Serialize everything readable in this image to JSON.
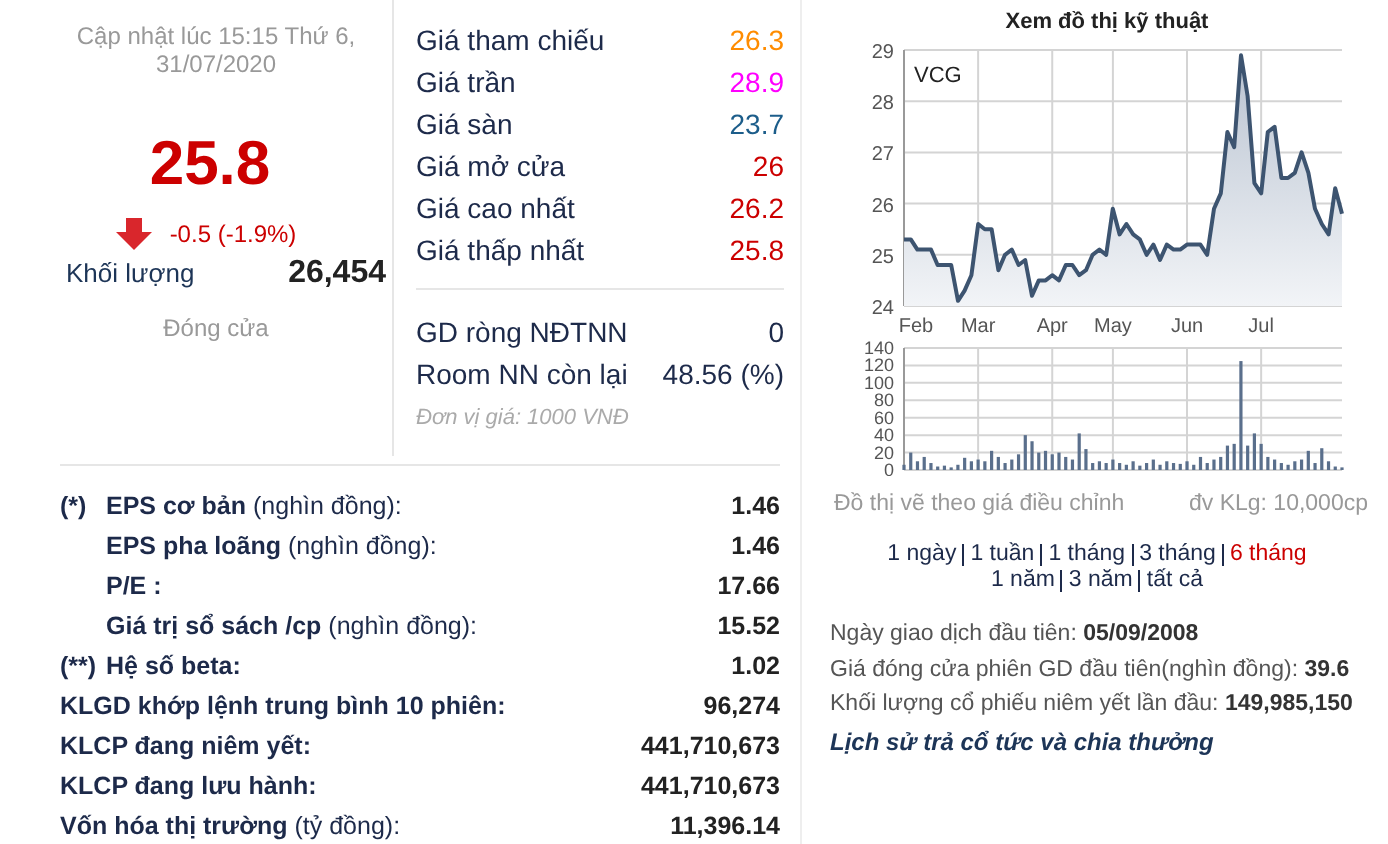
{
  "quote": {
    "updated": "Cập nhật lúc 15:15 Thứ 6, 31/07/2020",
    "price": "25.8",
    "trend_down": true,
    "change": "-0.5 (-1.9%)",
    "volume_label": "Khối lượng",
    "volume": "26,454",
    "status": "Đóng cửa"
  },
  "prices": [
    {
      "label": "Giá tham chiếu",
      "value": "26.3",
      "color": "#ff8c00"
    },
    {
      "label": "Giá trần",
      "value": "28.9",
      "color": "#ff00ff"
    },
    {
      "label": "Giá sàn",
      "value": "23.7",
      "color": "#1c5d8a"
    },
    {
      "label": "Giá mở cửa",
      "value": "26",
      "color": "#cc0000"
    },
    {
      "label": "Giá cao nhất",
      "value": "26.2",
      "color": "#cc0000"
    },
    {
      "label": "Giá thấp nhất",
      "value": "25.8",
      "color": "#cc0000"
    }
  ],
  "foreign": [
    {
      "label": "GD ròng NĐTNN",
      "value": "0"
    },
    {
      "label": "Room NN còn lại",
      "value": "48.56 (%)"
    }
  ],
  "price_unit": "Đơn vị giá: 1000 VNĐ",
  "stats": [
    {
      "marker": "(*)",
      "label": "**EPS cơ bản** (nghìn đồng):",
      "value": "1.46",
      "children": [
        {
          "label": "**EPS pha loãng** (nghìn đồng):",
          "value": "1.46"
        },
        {
          "label": "**P/E :**",
          "value": "17.66"
        },
        {
          "label": "**Giá trị sổ sách /cp** (nghìn đồng):",
          "value": "15.52"
        }
      ]
    },
    {
      "marker": "(**)",
      "label": "**Hệ số beta:**",
      "value": "1.02"
    },
    {
      "label": "**KLGD khớp lệnh trung bình 10 phiên:**",
      "value": "96,274"
    },
    {
      "label": "**KLCP đang niêm yết:**",
      "value": "441,710,673"
    },
    {
      "label": "**KLCP đang lưu hành:**",
      "value": "441,710,673"
    },
    {
      "label": "**Vốn hóa thị trường** (tỷ đồng):",
      "value": "11,396.14"
    }
  ],
  "chart": {
    "title": "Xem đồ thị kỹ thuật",
    "price_chart": {
      "chart_data": {
        "type": "area",
        "grid": true,
        "categories": [
          "Feb",
          null,
          null,
          null,
          null,
          null,
          null,
          null,
          null,
          null,
          null,
          "Mar",
          null,
          null,
          null,
          null,
          null,
          null,
          null,
          null,
          null,
          null,
          "Apr",
          null,
          null,
          null,
          null,
          null,
          null,
          null,
          null,
          "May",
          null,
          null,
          null,
          null,
          null,
          null,
          null,
          null,
          null,
          null,
          "Jun",
          null,
          null,
          null,
          null,
          null,
          null,
          null,
          null,
          null,
          null,
          "Jul",
          null,
          null,
          null,
          null,
          null,
          null,
          null,
          null,
          null,
          null,
          null,
          null
        ],
        "ylim": [
          24,
          29
        ],
        "yticks": [
          24,
          25,
          26,
          27,
          28,
          29
        ],
        "series": [
          {
            "name": "VCG",
            "color": "#3d5470",
            "values": [
              25.3,
              25.3,
              25.1,
              25.1,
              25.1,
              24.8,
              24.8,
              24.8,
              24.1,
              24.3,
              24.6,
              25.6,
              25.5,
              25.5,
              24.7,
              25.0,
              25.1,
              24.8,
              24.9,
              24.2,
              24.5,
              24.5,
              24.6,
              24.5,
              24.8,
              24.8,
              24.6,
              24.7,
              25.0,
              25.1,
              25.0,
              25.9,
              25.4,
              25.6,
              25.4,
              25.3,
              25.0,
              25.2,
              24.9,
              25.2,
              25.1,
              25.1,
              25.2,
              25.2,
              25.2,
              25.0,
              25.9,
              26.2,
              27.4,
              27.1,
              28.9,
              28.1,
              26.4,
              26.2,
              27.4,
              27.5,
              26.5,
              26.5,
              26.6,
              27.0,
              26.6,
              25.9,
              25.6,
              25.4,
              26.3,
              25.8
            ]
          }
        ]
      }
    },
    "volume_chart": {
      "chart_data": {
        "type": "bar",
        "grid": true,
        "categories": [
          null,
          null,
          null,
          null,
          null,
          null,
          null,
          null,
          null,
          null,
          null,
          null,
          null,
          null,
          null,
          null,
          null,
          null,
          null,
          null,
          null,
          null,
          null,
          null,
          null,
          null,
          null,
          null,
          null,
          null,
          null,
          null,
          null,
          null,
          null,
          null,
          null,
          null,
          null,
          null,
          null,
          null,
          null,
          null,
          null,
          null,
          null,
          null,
          null,
          null,
          null,
          null,
          null,
          null,
          null,
          null,
          null,
          null,
          null,
          null,
          null,
          null,
          null,
          null,
          null,
          null
        ],
        "ylim": [
          0,
          140
        ],
        "yticks": [
          0,
          20,
          40,
          60,
          80,
          100,
          120,
          140
        ],
        "series": [
          {
            "color": "#5a6f8c",
            "values": [
              6,
              20,
              10,
              15,
              8,
              4,
              5,
              3,
              6,
              14,
              10,
              12,
              10,
              22,
              15,
              8,
              12,
              18,
              40,
              33,
              20,
              22,
              18,
              20,
              15,
              12,
              42,
              24,
              8,
              10,
              8,
              12,
              8,
              6,
              10,
              5,
              8,
              12,
              6,
              10,
              8,
              7,
              10,
              6,
              15,
              8,
              12,
              15,
              28,
              30,
              125,
              28,
              42,
              30,
              15,
              12,
              8,
              6,
              10,
              12,
              22,
              8,
              25,
              10,
              4,
              3
            ]
          }
        ]
      }
    },
    "note": "Đồ thị vẽ theo giá điều chỉnh",
    "volume_unit": "đv KLg: 10,000cp",
    "period_rows": [
      {
        "items": [
          {
            "label": "1 ngày",
            "selected": false
          },
          {
            "label": "1 tuần",
            "selected": false
          },
          {
            "label": "1 tháng",
            "selected": false
          },
          {
            "label": "3 tháng",
            "selected": false
          },
          {
            "label": "6 tháng",
            "selected": true
          }
        ]
      },
      {
        "items": [
          {
            "label": "1 năm",
            "selected": false
          },
          {
            "label": "3 năm",
            "selected": false
          },
          {
            "label": "tất cả",
            "selected": false
          }
        ]
      }
    ]
  },
  "listing_info": [
    "Ngày giao dịch đầu tiên: **05/09/2008**",
    "Giá đóng cửa phiên GD đầu tiên(nghìn đồng): **39.6**",
    "Khối lượng cổ phiếu niêm yết lần đầu: **149,985,150**"
  ],
  "dividend_link": "Lịch sử trả cổ tức và chia thưởng"
}
